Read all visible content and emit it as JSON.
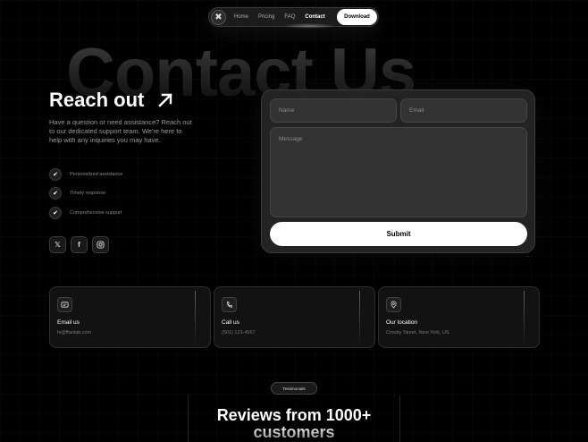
{
  "nav": {
    "logo_glyph": "✖",
    "links": [
      "Home",
      "Pricing",
      "FAQ",
      "Contact"
    ],
    "download_label": "Download"
  },
  "hero": {
    "bg_title": "Contact Us",
    "reach_title": "Reach out",
    "description": "Have a question or need assistance? Reach out to our dedicated support team. We're here to help with any inquiries you may have.",
    "features": [
      "Personalized assistance",
      "Timely response",
      "Comprehensive support"
    ],
    "socials": [
      "x-icon",
      "facebook-icon",
      "instagram-icon"
    ]
  },
  "form": {
    "name_placeholder": "Name",
    "email_placeholder": "Email",
    "message_placeholder": "Message",
    "submit_label": "Submit"
  },
  "cards": [
    {
      "icon": "message-icon",
      "title": "Email us",
      "value": "hi@ffanlab.com"
    },
    {
      "icon": "phone-icon",
      "title": "Call us",
      "value": "(501) 123-4567"
    },
    {
      "icon": "location-pin-icon",
      "title": "Our location",
      "value": "Crosby Street, New York, US"
    }
  ],
  "testimonials": {
    "pill_label": "Testimonials",
    "title_line1": "Reviews from 1000+",
    "title_line2": "customers"
  },
  "colors": {
    "background": "#000000",
    "accent": "#ffffff",
    "card": "#121212"
  }
}
